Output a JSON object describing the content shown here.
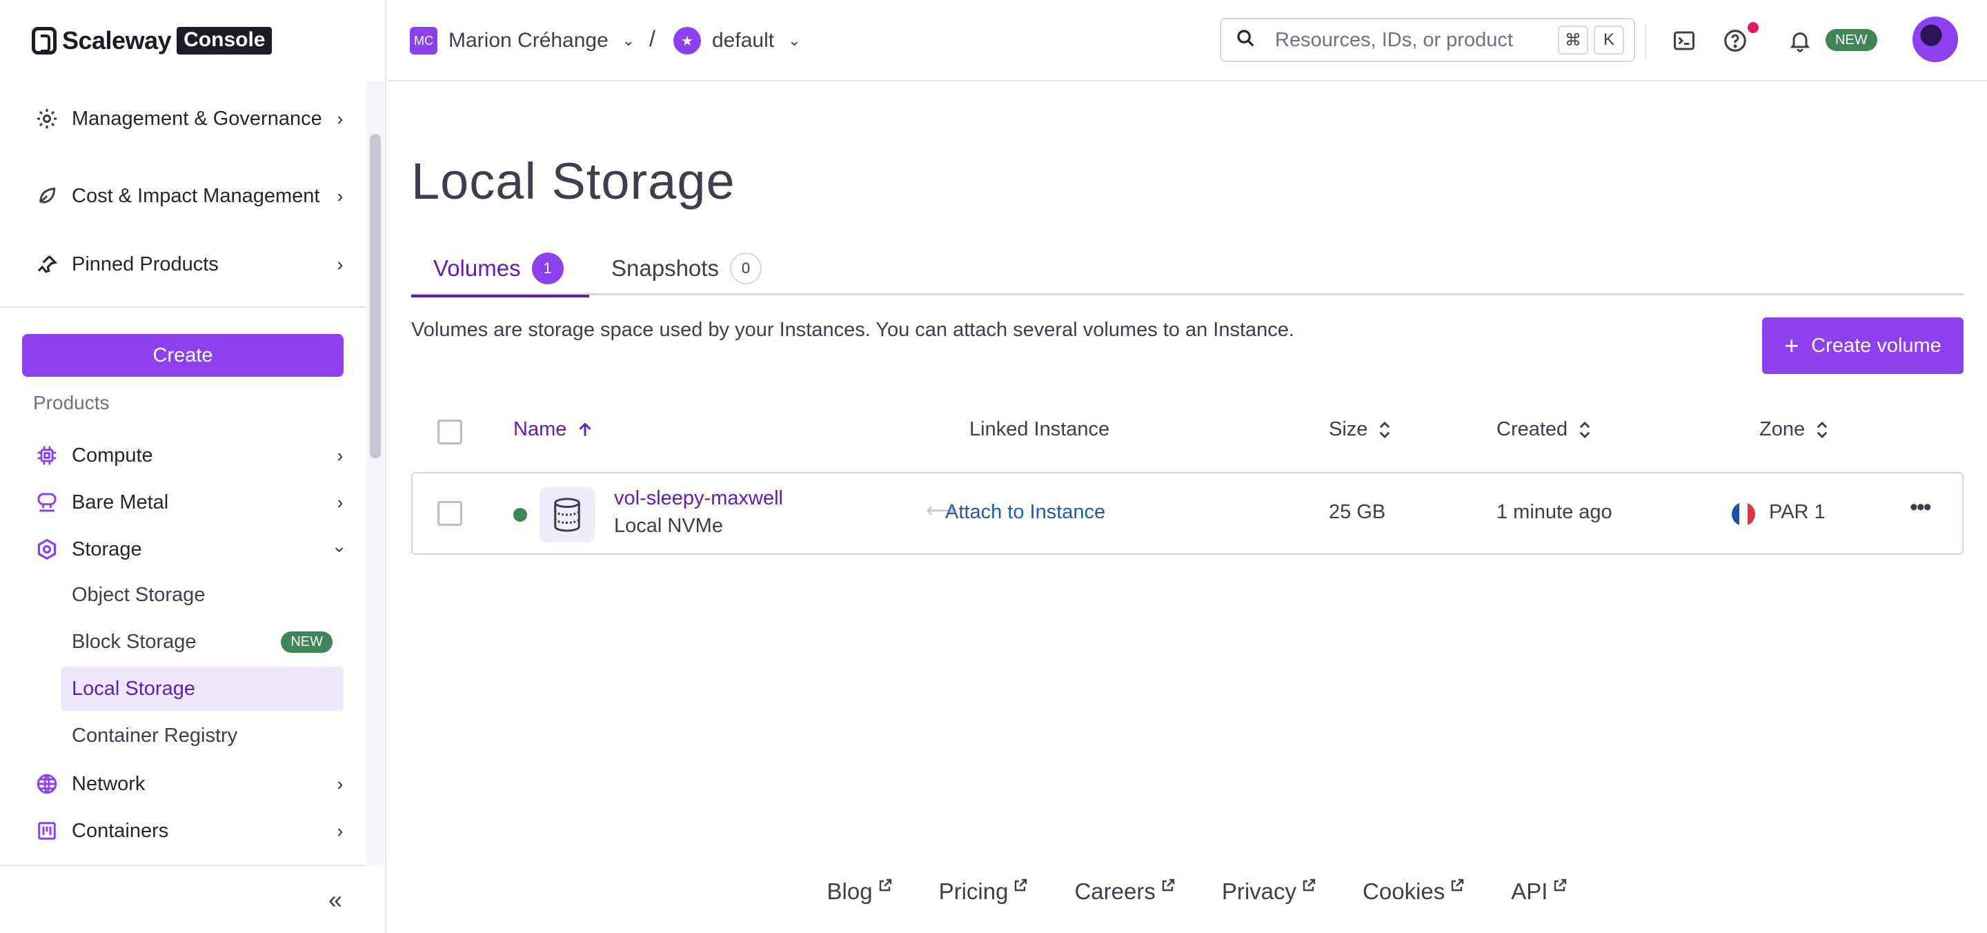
{
  "brand": {
    "name": "Scaleway",
    "badge": "Console"
  },
  "topbar": {
    "org_initials": "MC",
    "org_name": "Marion Créhange",
    "separator": "/",
    "project_name": "default",
    "search_placeholder": "Resources, IDs, or product",
    "shortcut_keys": [
      "⌘",
      "K"
    ],
    "new_badge": "NEW"
  },
  "sidebar": {
    "top_items": [
      {
        "label": "Management & Governance",
        "icon": "gear-icon"
      },
      {
        "label": "Cost & Impact Management",
        "icon": "leaf-icon"
      },
      {
        "label": "Pinned Products",
        "icon": "pin-icon"
      }
    ],
    "create_label": "Create",
    "section_label": "Products",
    "products": [
      {
        "label": "Compute",
        "icon": "chip-icon"
      },
      {
        "label": "Bare Metal",
        "icon": "server-icon"
      },
      {
        "label": "Storage",
        "icon": "hexagon-icon",
        "expanded": true
      },
      {
        "label": "Network",
        "icon": "globe-icon"
      },
      {
        "label": "Containers",
        "icon": "container-icon"
      }
    ],
    "storage_sub": [
      {
        "label": "Object Storage"
      },
      {
        "label": "Block Storage",
        "badge": "NEW"
      },
      {
        "label": "Local Storage",
        "active": true
      },
      {
        "label": "Container Registry"
      }
    ],
    "collapse_glyph": "«"
  },
  "main": {
    "title": "Local Storage",
    "tabs": [
      {
        "label": "Volumes",
        "count": "1",
        "active": true
      },
      {
        "label": "Snapshots",
        "count": "0",
        "active": false
      }
    ],
    "description": "Volumes are storage space used by your Instances. You can attach several volumes to an Instance.",
    "create_volume_label": "Create volume",
    "columns": [
      "Name",
      "Linked Instance",
      "Size",
      "Created",
      "Zone"
    ],
    "rows": [
      {
        "name": "vol-sleepy-maxwell",
        "type": "Local NVMe",
        "linked_instance": "Attach to Instance",
        "size": "25 GB",
        "created": "1 minute ago",
        "zone": "PAR 1",
        "status_color": "#3f8558"
      }
    ]
  },
  "footer": {
    "links": [
      "Blog",
      "Pricing",
      "Careers",
      "Privacy",
      "Cookies",
      "API"
    ]
  },
  "colors": {
    "accent": "#8c40ef",
    "accent_text": "#641cb3",
    "link": "#225da4",
    "success": "#3f8558",
    "notification": "#e51963"
  }
}
